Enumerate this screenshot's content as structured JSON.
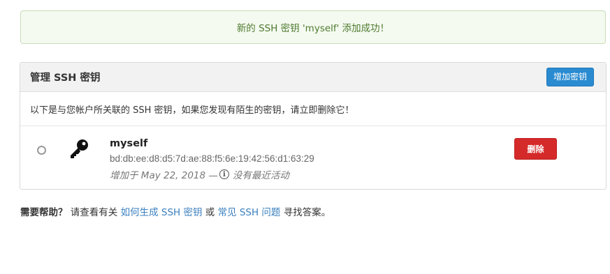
{
  "flash": {
    "message": "新的 SSH 密钥 'myself' 添加成功！"
  },
  "panel": {
    "title": "管理 SSH 密钥",
    "add_button": "增加密钥",
    "notice": "以下是与您帐户所关联的 SSH 密钥，如果您发现有陌生的密钥，请立即删除它！"
  },
  "keys": [
    {
      "name": "myself",
      "fingerprint": "bd:db:ee:d8:d5:7d:ae:88:f5:6e:19:42:56:d1:63:29",
      "added_prefix": "增加于 May 22, 2018 —",
      "activity": "没有最近活动",
      "delete_label": "删除",
      "icon": "key-icon"
    }
  ],
  "help": {
    "lead": "需要帮助？",
    "text1": "请查看有关",
    "link1": "如何生成 SSH 密钥",
    "text2": "或",
    "link2": "常见 SSH 问题",
    "text3": "寻找答案。"
  },
  "colors": {
    "flash_text": "#4e7a2e",
    "primary": "#2a8bd1",
    "danger": "#d52a2a",
    "link": "#3a7fbf"
  }
}
